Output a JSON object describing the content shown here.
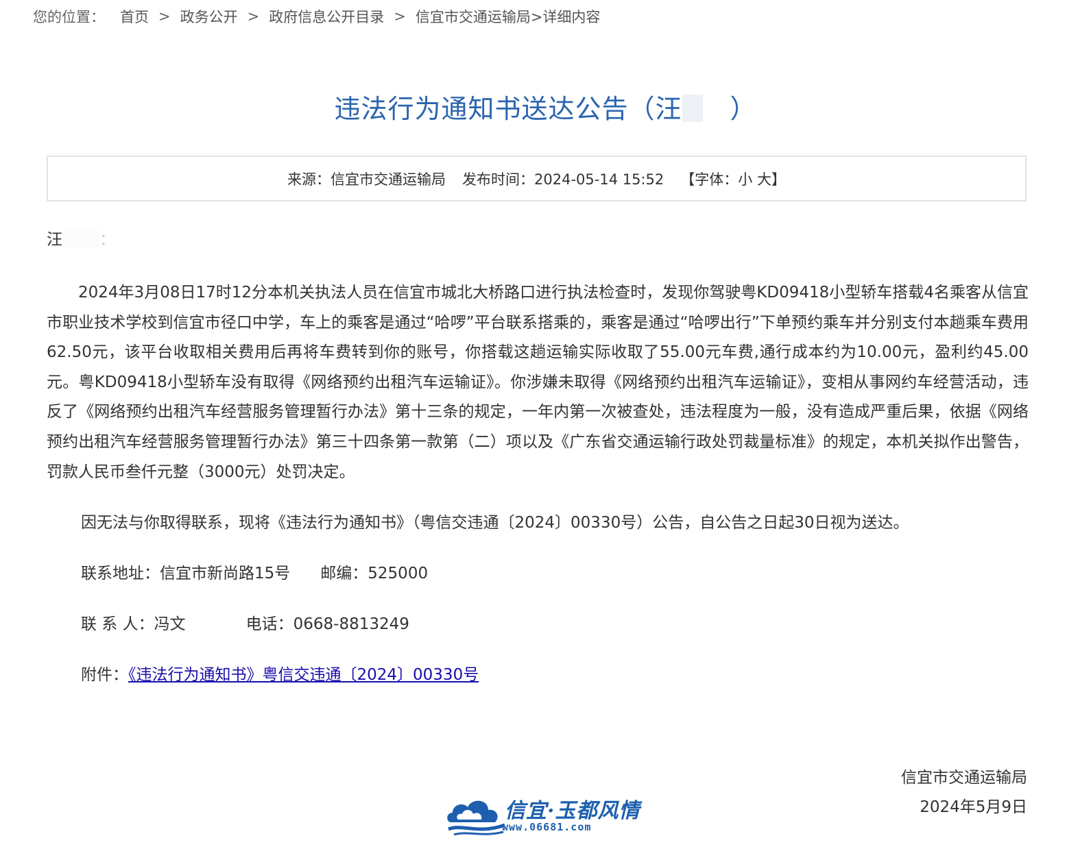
{
  "breadcrumb": {
    "prefix": "您的位置：",
    "items": [
      "首页",
      "政务公开",
      "政府信息公开目录",
      "信宜市交通运输局"
    ],
    "separator": ">",
    "current": ">详细内容"
  },
  "article": {
    "title": "违法行为通知书送达公告（汪",
    "title_close": "）",
    "meta": {
      "source": "来源：信宜市交通运输局",
      "publish_time": "发布时间：2024-05-14 15:52",
      "font_open": "【字体：",
      "font_small": "小",
      "font_large": "大",
      "font_close": "】"
    },
    "salutation_name": "汪",
    "salutation_colon": "：",
    "body": "2024年3月08日17时12分本机关执法人员在信宜市城北大桥路口进行执法检查时，发现你驾驶粤KD09418小型轿车搭载4名乘客从信宜市职业技术学校到信宜市径口中学，车上的乘客是通过“哈啰”平台联系搭乘的，乘客是通过“哈啰出行”下单预约乘车并分别支付本趟乘车费用62.50元，该平台收取相关费用后再将车费转到你的账号，你搭载这趟运输实际收取了55.00元车费,通行成本约为10.00元，盈利约45.00元。粤KD09418小型轿车没有取得《网络预约出租汽车运输证》。你涉嫌未取得《网络预约出租汽车运输证》，变相从事网约车经营活动，违反了《网络预约出租汽车经营服务管理暂行办法》第十三条的规定，一年内第一次被查处，违法程度为一般，没有造成严重后果，依据《网络预约出租汽车经营服务管理暂行办法》第三十四条第一款第（二）项以及《广东省交通运输行政处罚裁量标准》的规定，本机关拟作出警告，罚款人民币叁仟元整（3000元）处罚决定。",
    "notice": "因无法与你取得联系，现将《违法行为通知书》（粤信交违通〔2024〕00330号）公告，自公告之日起30日视为送达。",
    "address": "联系地址：信宜市新尚路15号",
    "postcode": "邮编：525000",
    "contact_person": "联 系 人：冯文",
    "phone": "电话：0668-8813249",
    "attachment_label": "附件：",
    "attachment_link": "《违法行为通知书》粤信交违通〔2024〕00330号",
    "signature_org": "信宜市交通运输局",
    "signature_date": "2024年5月9日"
  },
  "watermark": {
    "text": "信宜·玉都风情",
    "url": "www.06681.com"
  },
  "colors": {
    "title": "#2a64ae",
    "link": "#1a0dab",
    "text": "#333333",
    "border": "#e2e2e2",
    "watermark": "#1d5fae"
  }
}
